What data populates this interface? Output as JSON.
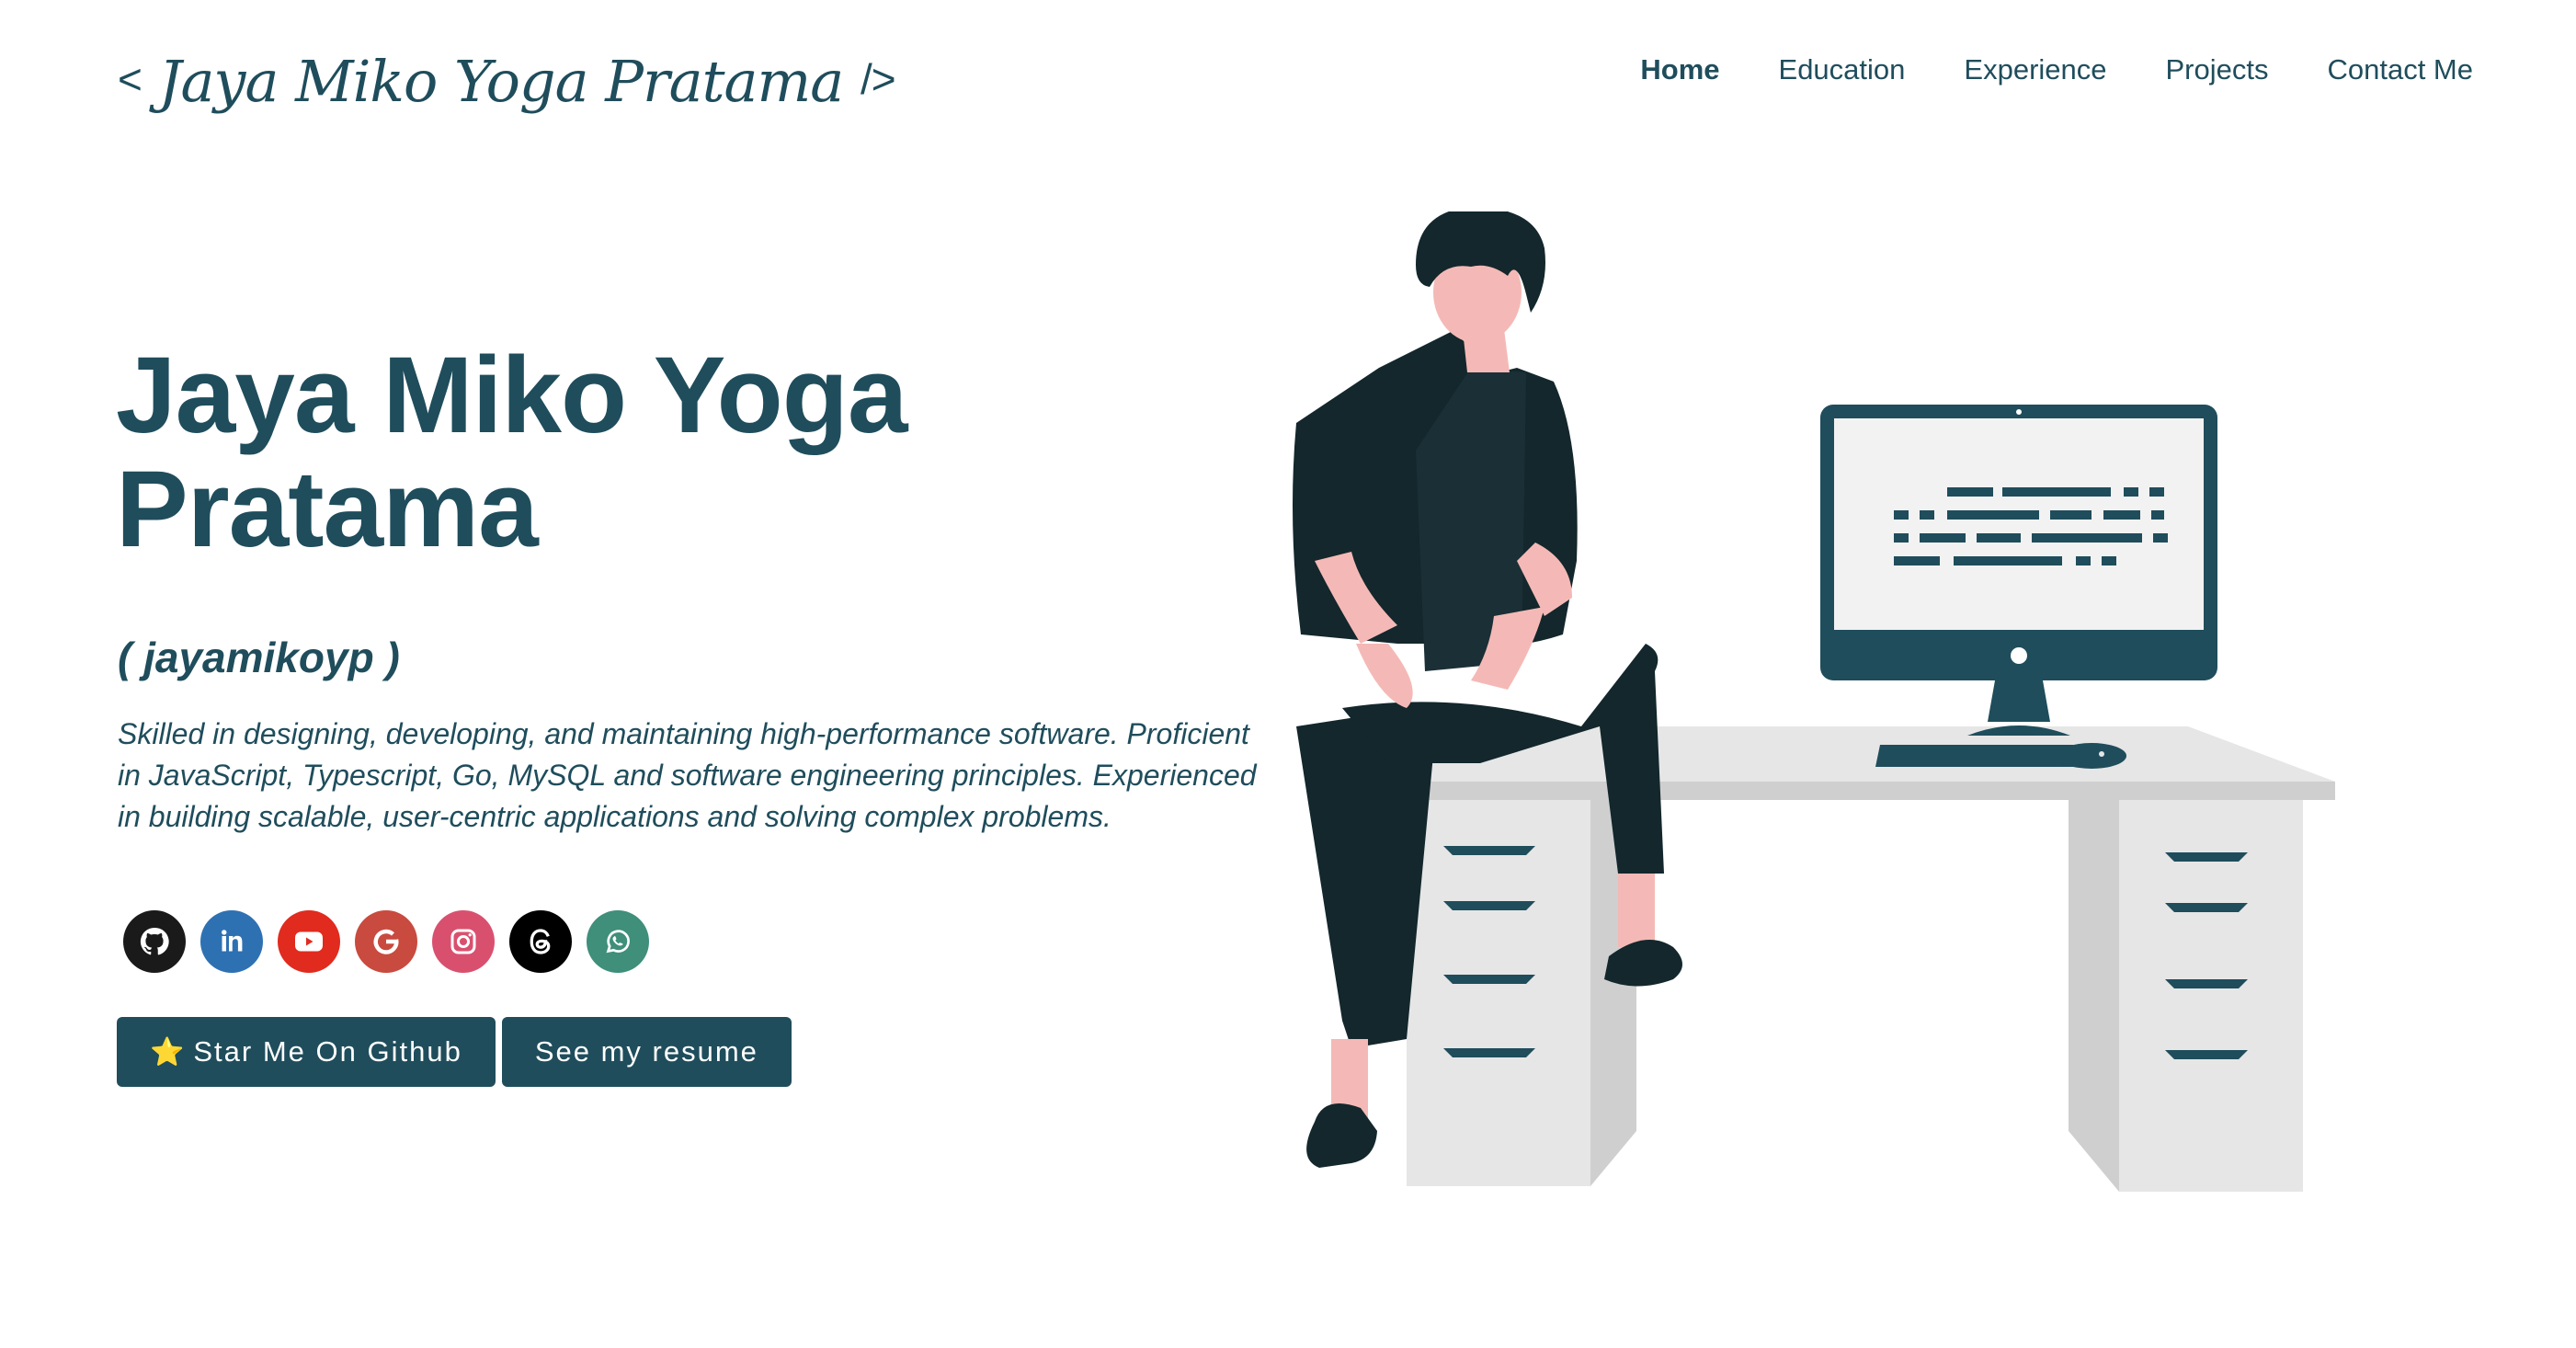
{
  "header": {
    "logo_open": "<",
    "logo_name": "Jaya Miko Yoga Pratama",
    "logo_close": "/>",
    "nav": [
      "Home",
      "Education",
      "Experience",
      "Projects",
      "Contact Me"
    ]
  },
  "hero": {
    "title_line1": "Jaya Miko Yoga",
    "title_line2": "Pratama",
    "handle": "( jayamikoyp )",
    "bio": "Skilled in designing, developing, and maintaining high-performance software. Proficient in JavaScript, Typescript, Go, MySQL and software engineering principles. Experienced in building scalable, user-centric applications and solving complex problems."
  },
  "socials": [
    {
      "name": "github-icon",
      "color": "#1a1a1a"
    },
    {
      "name": "linkedin-icon",
      "color": "#2e71b3"
    },
    {
      "name": "youtube-icon",
      "color": "#e12b1e"
    },
    {
      "name": "google-icon",
      "color": "#c94a3e"
    },
    {
      "name": "instagram-icon",
      "color": "#d9506f"
    },
    {
      "name": "threads-icon",
      "color": "#000000"
    },
    {
      "name": "whatsapp-icon",
      "color": "#3f8f7a"
    }
  ],
  "buttons": {
    "github_star": "⭐",
    "github_label": "Star Me On Github",
    "resume_label": "See my resume"
  },
  "colors": {
    "primary": "#1f4d5c",
    "background": "#ffffff",
    "skin": "#f4b9b6",
    "dark_figure": "#13272c",
    "desk": "#e6e6e6",
    "desk_shadow": "#cfcfcf"
  }
}
